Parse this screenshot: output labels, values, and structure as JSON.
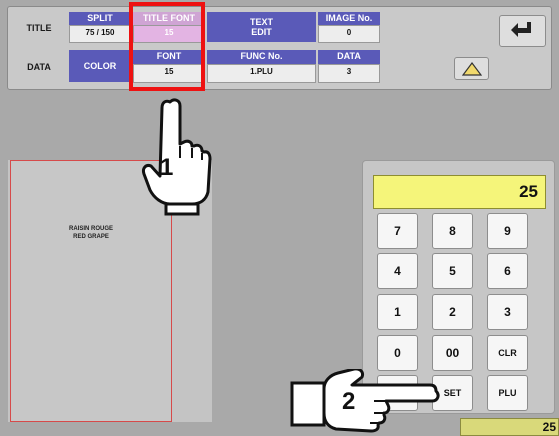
{
  "top": {
    "row_labels": {
      "title": "TITLE",
      "data": "DATA"
    },
    "row1": [
      {
        "header": "SPLIT",
        "value": "75 / 150"
      },
      {
        "header": "TITLE FONT",
        "value": "15"
      },
      {
        "header": "TEXT\nEDIT"
      },
      {
        "header": "IMAGE No.",
        "value": "0"
      }
    ],
    "row2": [
      {
        "header": "COLOR"
      },
      {
        "header": "FONT",
        "value": "15"
      },
      {
        "header": "FUNC No.",
        "value": "1.PLU"
      },
      {
        "header": "DATA",
        "value": "3"
      }
    ],
    "icons": {
      "back": "return-arrow-icon",
      "up": "triangle-up-icon"
    }
  },
  "preview": {
    "line1": "RAISIN ROUGE",
    "line2": "RED GRAPE"
  },
  "keypad": {
    "display_value": "25",
    "keys": [
      "7",
      "8",
      "9",
      "4",
      "5",
      "6",
      "1",
      "2",
      "3",
      "0",
      "00",
      "CLR",
      "",
      "SET",
      "PLU"
    ]
  },
  "bottom_value": "25",
  "annotations": {
    "step1": "1",
    "step2": "2"
  },
  "colors": {
    "header_blue": "#5a5ab8",
    "highlight_red": "#ee1111",
    "display_yellow": "#f5f57a"
  }
}
